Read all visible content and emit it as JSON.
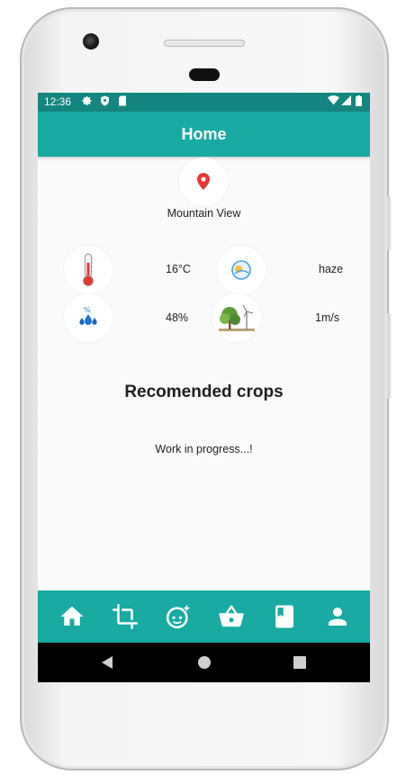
{
  "status_bar": {
    "time": "12:36",
    "left_icons": [
      "gear-icon",
      "shield-icon",
      "sd-card-icon"
    ],
    "right_icons": [
      "wifi-icon",
      "signal-icon",
      "battery-icon"
    ]
  },
  "app_bar": {
    "title": "Home"
  },
  "location": {
    "name": "Mountain View",
    "icon": "location-pin-icon"
  },
  "weather": {
    "temperature": "16°C",
    "condition": "haze",
    "humidity": "48%",
    "wind": "1m/s"
  },
  "crops": {
    "heading": "Recomended crops",
    "status": "Work in progress...!"
  },
  "bottom_nav": [
    {
      "name": "home",
      "icon": "home-icon"
    },
    {
      "name": "crop",
      "icon": "crop-icon"
    },
    {
      "name": "face",
      "icon": "face-icon"
    },
    {
      "name": "basket",
      "icon": "basket-icon"
    },
    {
      "name": "book",
      "icon": "book-icon"
    },
    {
      "name": "profile",
      "icon": "person-icon"
    }
  ],
  "colors": {
    "status_bar": "#15857f",
    "primary": "#18aaa3",
    "background": "#fafafa",
    "pin": "#e53935"
  }
}
